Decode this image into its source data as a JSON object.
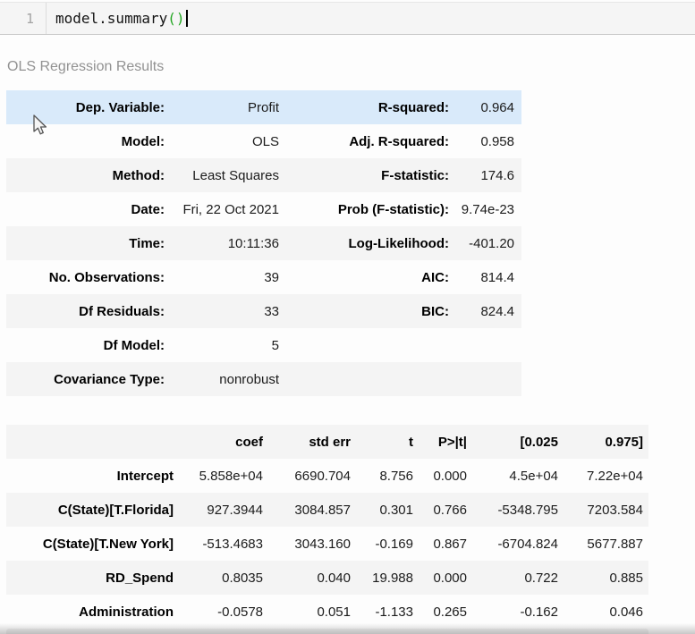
{
  "code_cell": {
    "line_number": "1",
    "code_main": "model.summary",
    "code_paren": "()"
  },
  "output_title": "OLS Regression Results",
  "summary_table": {
    "rows": [
      {
        "l1": "Dep. Variable:",
        "v1": "Profit",
        "l2": "R-squared:",
        "v2": "0.964",
        "highlight": true
      },
      {
        "l1": "Model:",
        "v1": "OLS",
        "l2": "Adj. R-squared:",
        "v2": "0.958"
      },
      {
        "l1": "Method:",
        "v1": "Least Squares",
        "l2": "F-statistic:",
        "v2": "174.6"
      },
      {
        "l1": "Date:",
        "v1": "Fri, 22 Oct 2021",
        "l2": "Prob (F-statistic):",
        "v2": "9.74e-23"
      },
      {
        "l1": "Time:",
        "v1": "10:11:36",
        "l2": "Log-Likelihood:",
        "v2": "-401.20"
      },
      {
        "l1": "No. Observations:",
        "v1": "39",
        "l2": "AIC:",
        "v2": "814.4"
      },
      {
        "l1": "Df Residuals:",
        "v1": "33",
        "l2": "BIC:",
        "v2": "824.4"
      },
      {
        "l1": "Df Model:",
        "v1": "5",
        "l2": "",
        "v2": ""
      },
      {
        "l1": "Covariance Type:",
        "v1": "nonrobust",
        "l2": "",
        "v2": ""
      }
    ]
  },
  "coef_table": {
    "headers": [
      "",
      "coef",
      "std err",
      "t",
      "P>|t|",
      "[0.025",
      "0.975]"
    ],
    "rows": [
      [
        "Intercept",
        "5.858e+04",
        "6690.704",
        "8.756",
        "0.000",
        "4.5e+04",
        "7.22e+04"
      ],
      [
        "C(State)[T.Florida]",
        "927.3944",
        "3084.857",
        "0.301",
        "0.766",
        "-5348.795",
        "7203.584"
      ],
      [
        "C(State)[T.New York]",
        "-513.4683",
        "3043.160",
        "-0.169",
        "0.867",
        "-6704.824",
        "5677.887"
      ],
      [
        "RD_Spend",
        "0.8035",
        "0.040",
        "19.988",
        "0.000",
        "0.722",
        "0.885"
      ],
      [
        "Administration",
        "-0.0578",
        "0.051",
        "-1.133",
        "0.265",
        "-0.162",
        "0.046"
      ]
    ]
  },
  "colors": {
    "row_hover_blue": "#d9eafa",
    "row_stripe_gray": "#f4f4f4",
    "bracket_green": "#23a622",
    "cell_background": "#f5f5f5"
  }
}
